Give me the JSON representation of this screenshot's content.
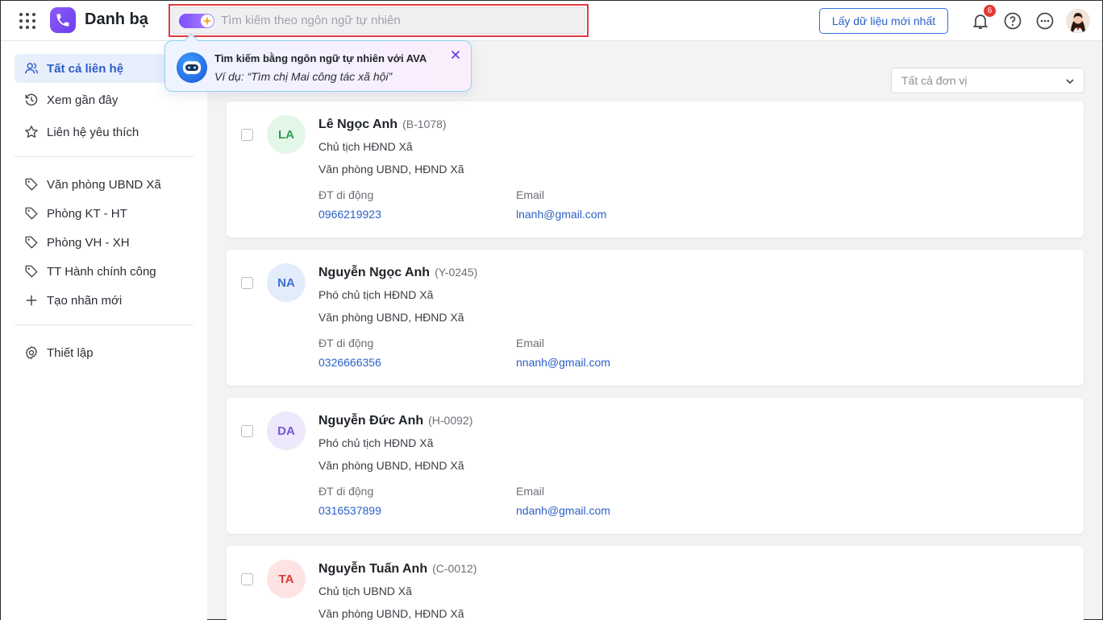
{
  "header": {
    "app_title": "Danh bạ",
    "search_placeholder": "Tìm kiếm theo ngôn ngữ tự nhiên",
    "refresh_label": "Lấy dữ liệu mới nhất",
    "notification_count": "6"
  },
  "ava_tip": {
    "title": "Tìm kiếm bằng ngôn ngữ tự nhiên với AVA",
    "example": "Ví dụ: “Tìm chị Mai công tác xã hội”"
  },
  "sidebar": {
    "all_contacts": "Tất cả liên hệ",
    "recent": "Xem gần đây",
    "favorites": "Liên hệ yêu thích",
    "labels": [
      "Văn phòng UBND Xã",
      "Phòng KT - HT",
      "Phòng VH - XH",
      "TT Hành chính công"
    ],
    "new_label": "Tạo nhãn mới",
    "settings": "Thiết lập"
  },
  "filter": {
    "unit_value": "Tất cả đơn vị"
  },
  "contact_fields": {
    "mobile_label": "ĐT di động",
    "email_label": "Email"
  },
  "contacts": [
    {
      "initials": "LA",
      "name": "Lê Ngọc Anh",
      "code": "(B-1078)",
      "position": "Chủ tịch HĐND Xã",
      "department": "Văn phòng UBND, HĐND Xã",
      "mobile": "0966219923",
      "email": "lnanh@gmail.com",
      "avatar_bg": "#e3f7e8",
      "avatar_fg": "#2f9e55"
    },
    {
      "initials": "NA",
      "name": "Nguyễn Ngọc Anh",
      "code": "(Y-0245)",
      "position": "Phó chủ tịch HĐND Xã",
      "department": "Văn phòng UBND, HĐND Xã",
      "mobile": "0326666356",
      "email": "nnanh@gmail.com",
      "avatar_bg": "#e2ecfb",
      "avatar_fg": "#3b6fd1"
    },
    {
      "initials": "DA",
      "name": "Nguyễn Đức Anh",
      "code": "(H-0092)",
      "position": "Phó chủ tịch HĐND Xã",
      "department": "Văn phòng UBND, HĐND Xã",
      "mobile": "0316537899",
      "email": "ndanh@gmail.com",
      "avatar_bg": "#ede8fb",
      "avatar_fg": "#7a55d6"
    },
    {
      "initials": "TA",
      "name": "Nguyễn Tuấn Anh",
      "code": "(C-0012)",
      "position": "Chủ tịch UBND Xã",
      "department": "Văn phòng UBND, HĐND Xã",
      "mobile": "",
      "email": "",
      "avatar_bg": "#fde3e3",
      "avatar_fg": "#d83b3b"
    }
  ]
}
